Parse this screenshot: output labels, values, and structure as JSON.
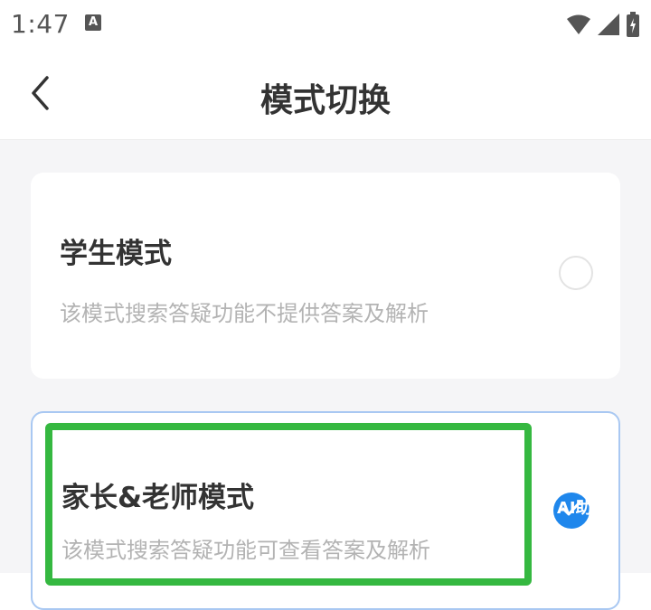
{
  "status_bar": {
    "time": "1:47",
    "notification_icon": "a-badge-icon",
    "wifi_icon": "wifi-icon",
    "signal_icon": "cell-signal-icon",
    "battery_icon": "battery-charging-icon"
  },
  "header": {
    "back_icon": "chevron-left-icon",
    "title": "模式切换"
  },
  "modes": [
    {
      "title": "学生模式",
      "description": "该模式搜索答疑功能不提供答案及解析",
      "selected": false
    },
    {
      "title": "家长&老师模式",
      "description": "该模式搜索答疑功能可查看答案及解析",
      "selected": true
    }
  ],
  "overlay": {
    "label": "AI助手"
  },
  "colors": {
    "accent": "#1f87ec",
    "highlight": "#35b840",
    "selected_border": "#a9c8f2",
    "background": "#f5f5f7"
  }
}
